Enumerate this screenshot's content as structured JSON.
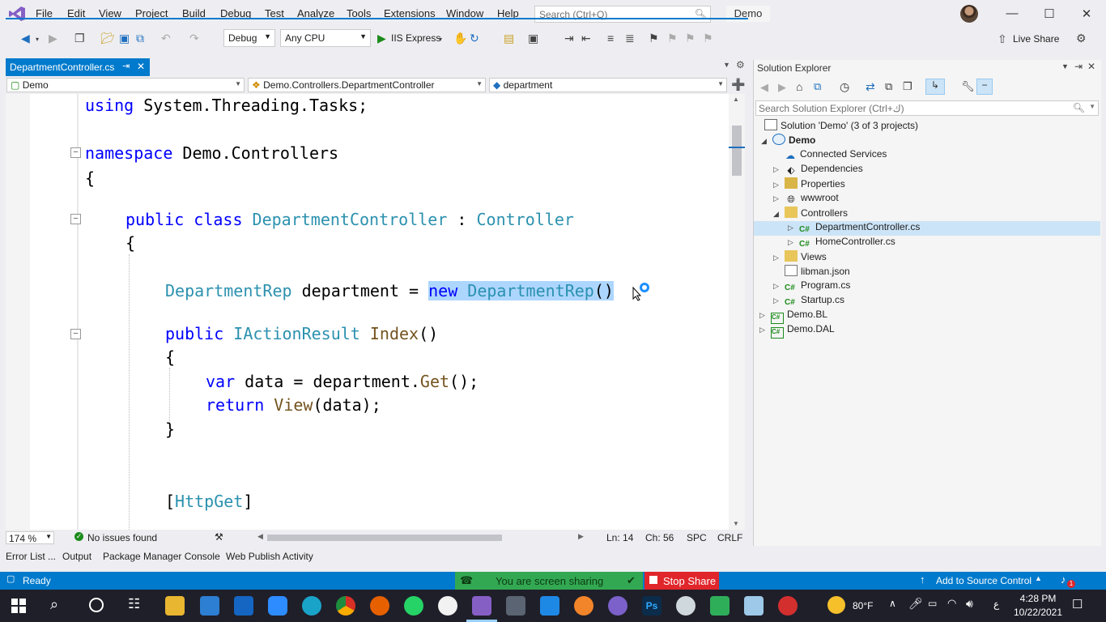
{
  "menu": {
    "items": [
      "File",
      "Edit",
      "View",
      "Project",
      "Build",
      "Debug",
      "Test",
      "Analyze",
      "Tools",
      "Extensions",
      "Window",
      "Help"
    ],
    "search_placeholder": "Search (Ctrl+Q)",
    "project_badge": "Demo"
  },
  "toolbar": {
    "config": "Debug",
    "platform": "Any CPU",
    "run_label": "IIS Express",
    "live_share": "Live Share"
  },
  "tab": {
    "name": "DepartmentController.cs"
  },
  "navbar": {
    "project": "Demo",
    "type": "Demo.Controllers.DepartmentController",
    "member": "department"
  },
  "code": {
    "l1_kw": "using",
    "l1_rest": " System.Threading.Tasks;",
    "l2_kw": "namespace",
    "l2_rest": " Demo.Controllers",
    "l3": "{",
    "l4_kw": "public class",
    "l4_type": "DepartmentController",
    "l4_colon": " : ",
    "l4_base": "Controller",
    "l5": "{",
    "l6_type": "DepartmentRep",
    "l6_mid": " department = ",
    "l6_new": "new",
    "l6_sp": " ",
    "l6_ctor": "DepartmentRep",
    "l6_end": "()",
    "l7_kw": "public",
    "l7_type": "IActionResult",
    "l7_fn": "Index",
    "l7_end": "()",
    "l8": "{",
    "l9_kw": "var",
    "l9_mid": " data = department.",
    "l9_fn": "Get",
    "l9_end": "();",
    "l10_kw": "return",
    "l10_fn": "View",
    "l10_end": "(data);",
    "l11": "}",
    "l12_open": "[",
    "l12_attr": "HttpGet",
    "l12_close": "]"
  },
  "editor_status": {
    "zoom": "174 %",
    "issues": "No issues found",
    "line": "Ln: 14",
    "col": "Ch: 56",
    "spc": "SPC",
    "crlf": "CRLF"
  },
  "bottom_tabs": [
    "Error List ...",
    "Output",
    "Package Manager Console",
    "Web Publish Activity"
  ],
  "status": {
    "ready": "Ready",
    "sharing": "You are screen sharing",
    "stop_share": "Stop Share",
    "source_control": "Add to Source Control",
    "notif_count": "1"
  },
  "solution_explorer": {
    "title": "Solution Explorer",
    "search_placeholder": "Search Solution Explorer (Ctrl+ك)",
    "solution": "Solution 'Demo' (3 of 3 projects)",
    "items": [
      "Demo",
      "Connected Services",
      "Dependencies",
      "Properties",
      "wwwroot",
      "Controllers",
      "DepartmentController.cs",
      "HomeController.cs",
      "Views",
      "libman.json",
      "Program.cs",
      "Startup.cs",
      "Demo.BL",
      "Demo.DAL"
    ]
  },
  "taskbar": {
    "weather": "80°F",
    "time": "4:28 PM",
    "date": "10/22/2021",
    "lang": "ع"
  },
  "colors": {
    "accent": "#007acc",
    "keyword": "#0000ff",
    "type": "#2b91af",
    "method": "#74531f",
    "selection": "#add6ff",
    "share_green": "#33a852",
    "stop_red": "#e0262b"
  }
}
